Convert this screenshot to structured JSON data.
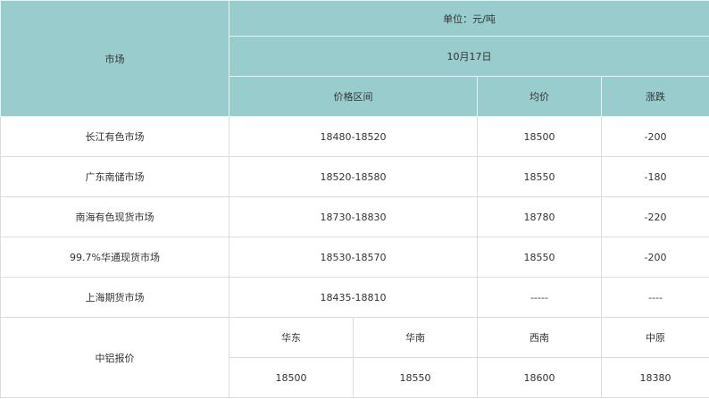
{
  "header": {
    "market_label": "市场",
    "unit_label": "单位：元/吨",
    "date_label": "10月17日",
    "columns": [
      "价格区间",
      "均价",
      "涨跌"
    ]
  },
  "rows": [
    {
      "market": "长江有色市场",
      "range": "18480-18520",
      "avg": "18500",
      "change": "-200"
    },
    {
      "market": "广东南储市场",
      "range": "18520-18580",
      "avg": "18550",
      "change": "-180"
    },
    {
      "market": "南海有色现货市场",
      "range": "18730-18830",
      "avg": "18780",
      "change": "-220"
    },
    {
      "market": "99.7%华通现货市场",
      "range": "18530-18570",
      "avg": "18550",
      "change": "-200"
    },
    {
      "market": "上海期货市场",
      "range": "18435-18810",
      "avg": "-----",
      "change": "----"
    }
  ],
  "chalco": {
    "label": "中铝报价",
    "regions": [
      "华东",
      "华南",
      "西南",
      "中原"
    ],
    "prices": [
      "18500",
      "18550",
      "18600",
      "18380"
    ]
  }
}
